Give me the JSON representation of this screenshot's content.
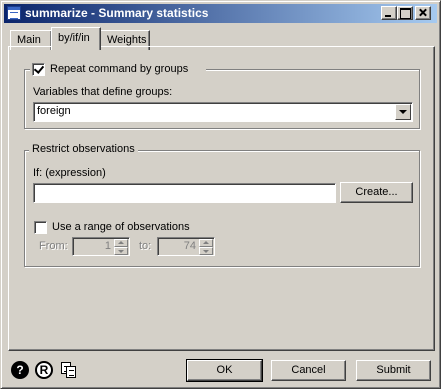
{
  "window": {
    "title": "summarize - Summary statistics"
  },
  "tabs": [
    {
      "label": "Main",
      "active": false
    },
    {
      "label": "by/if/in",
      "active": true
    },
    {
      "label": "Weights",
      "active": false
    }
  ],
  "by_group": {
    "repeat_label": "Repeat command by groups",
    "repeat_checked": true,
    "variables_label": "Variables that define groups:",
    "variables_value": "foreign"
  },
  "restrict": {
    "legend": "Restrict observations",
    "if_label": "If: (expression)",
    "if_value": "",
    "create_label": "Create...",
    "range_label": "Use a range of observations",
    "range_checked": false,
    "from_label": "From:",
    "from_value": "1",
    "to_label": "to:",
    "to_value": "74"
  },
  "footer": {
    "help_icon_glyph": "?",
    "reset_icon_glyph": "R",
    "ok_label": "OK",
    "cancel_label": "Cancel",
    "submit_label": "Submit"
  }
}
